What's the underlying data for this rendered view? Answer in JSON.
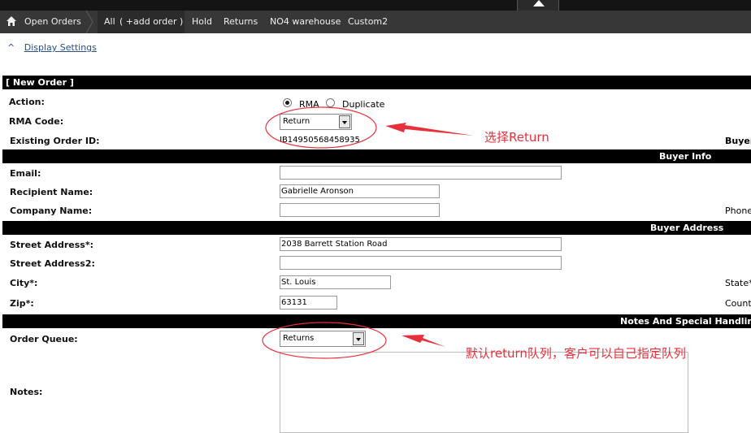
{
  "nav": {
    "items": [
      "Open Orders",
      "All",
      "( +add order )",
      "Hold",
      "Returns",
      "NO4 warehouse",
      "Custom2"
    ]
  },
  "settings": {
    "link": "Display Settings",
    "caret": "^"
  },
  "form": {
    "header": "[ New Order ]",
    "action_label": "Action:",
    "action_options": [
      "RMA",
      "Duplicate"
    ],
    "rma_code_label": "RMA Code:",
    "rma_code_value": "Return",
    "existing_order_label": "Existing Order ID:",
    "existing_order_value": "IB14950568458935",
    "buyer_label_right": "Buyer",
    "buyer_info_header": "Buyer Info",
    "email_label": "Email:",
    "email_value": "",
    "recipient_label": "Recipient Name:",
    "recipient_value": "Gabrielle Aronson",
    "company_label": "Company Name:",
    "company_value": "",
    "phone_label_right": "Phone",
    "buyer_address_header": "Buyer Address",
    "street_label": "Street Address*:",
    "street_value": "2038 Barrett Station Road",
    "street2_label": "Street Address2:",
    "street2_value": "",
    "city_label": "City*:",
    "city_value": "St. Louis",
    "state_label_right": "State*",
    "zip_label": "Zip*:",
    "zip_value": "63131",
    "country_label_right": "Count",
    "notes_header": "Notes And Special Handling",
    "queue_label": "Order Queue:",
    "queue_value": "Returns",
    "notes_label": "Notes:"
  },
  "annotations": {
    "rma_note": "选择Return",
    "queue_note": "默认return队列，客户可以自己指定队列"
  },
  "colors": {
    "annotation": "#e8303a",
    "nav_bg": "#373737",
    "section_bg": "#000000"
  }
}
